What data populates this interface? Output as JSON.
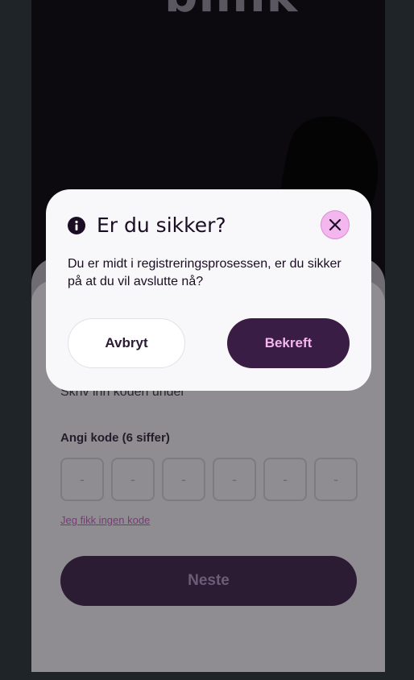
{
  "background": {
    "brand_text": "blink"
  },
  "sheet": {
    "subtitle": "Skriv inn koden under",
    "code_label": "Angi kode (6 siffer)",
    "code_placeholders": [
      "-",
      "-",
      "-",
      "-",
      "-",
      "-"
    ],
    "no_code_link": "Jeg fikk ingen kode",
    "next_label": "Neste"
  },
  "dialog": {
    "icon": "info-icon",
    "title": "Er du sikker?",
    "body": "Du er midt i registreringsprosessen, er du sikker på at du vil avslutte nå?",
    "cancel_label": "Avbryt",
    "confirm_label": "Bekreft",
    "close_icon": "close-icon"
  },
  "colors": {
    "accent_dark": "#3a1d45",
    "accent_pink": "#f3b6ef",
    "dialog_bg": "#f8f7f9"
  }
}
